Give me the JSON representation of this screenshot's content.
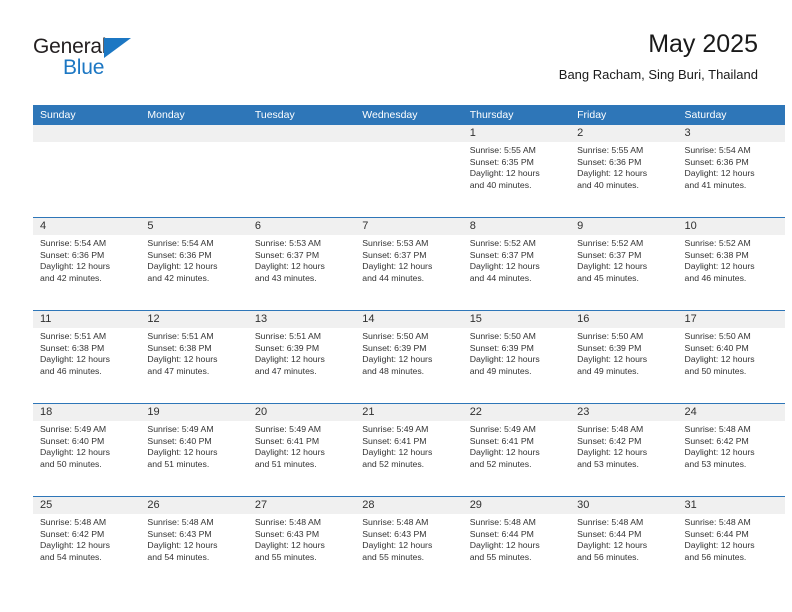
{
  "brand": {
    "name_top": "General",
    "name_bottom": "Blue",
    "accent_color": "#1c77c3"
  },
  "header": {
    "title": "May 2025",
    "subtitle": "Bang Racham, Sing Buri, Thailand"
  },
  "theme": {
    "header_blue": "#2e76b8",
    "day_number_bg": "#f0f0f0",
    "text_color": "#333333"
  },
  "weekdays": [
    "Sunday",
    "Monday",
    "Tuesday",
    "Wednesday",
    "Thursday",
    "Friday",
    "Saturday"
  ],
  "weeks": [
    [
      {
        "day": "",
        "empty": true
      },
      {
        "day": "",
        "empty": true
      },
      {
        "day": "",
        "empty": true
      },
      {
        "day": "",
        "empty": true
      },
      {
        "day": "1",
        "sunrise": "Sunrise: 5:55 AM",
        "sunset": "Sunset: 6:35 PM",
        "daylight_1": "Daylight: 12 hours",
        "daylight_2": "and 40 minutes."
      },
      {
        "day": "2",
        "sunrise": "Sunrise: 5:55 AM",
        "sunset": "Sunset: 6:36 PM",
        "daylight_1": "Daylight: 12 hours",
        "daylight_2": "and 40 minutes."
      },
      {
        "day": "3",
        "sunrise": "Sunrise: 5:54 AM",
        "sunset": "Sunset: 6:36 PM",
        "daylight_1": "Daylight: 12 hours",
        "daylight_2": "and 41 minutes."
      }
    ],
    [
      {
        "day": "4",
        "sunrise": "Sunrise: 5:54 AM",
        "sunset": "Sunset: 6:36 PM",
        "daylight_1": "Daylight: 12 hours",
        "daylight_2": "and 42 minutes."
      },
      {
        "day": "5",
        "sunrise": "Sunrise: 5:54 AM",
        "sunset": "Sunset: 6:36 PM",
        "daylight_1": "Daylight: 12 hours",
        "daylight_2": "and 42 minutes."
      },
      {
        "day": "6",
        "sunrise": "Sunrise: 5:53 AM",
        "sunset": "Sunset: 6:37 PM",
        "daylight_1": "Daylight: 12 hours",
        "daylight_2": "and 43 minutes."
      },
      {
        "day": "7",
        "sunrise": "Sunrise: 5:53 AM",
        "sunset": "Sunset: 6:37 PM",
        "daylight_1": "Daylight: 12 hours",
        "daylight_2": "and 44 minutes."
      },
      {
        "day": "8",
        "sunrise": "Sunrise: 5:52 AM",
        "sunset": "Sunset: 6:37 PM",
        "daylight_1": "Daylight: 12 hours",
        "daylight_2": "and 44 minutes."
      },
      {
        "day": "9",
        "sunrise": "Sunrise: 5:52 AM",
        "sunset": "Sunset: 6:37 PM",
        "daylight_1": "Daylight: 12 hours",
        "daylight_2": "and 45 minutes."
      },
      {
        "day": "10",
        "sunrise": "Sunrise: 5:52 AM",
        "sunset": "Sunset: 6:38 PM",
        "daylight_1": "Daylight: 12 hours",
        "daylight_2": "and 46 minutes."
      }
    ],
    [
      {
        "day": "11",
        "sunrise": "Sunrise: 5:51 AM",
        "sunset": "Sunset: 6:38 PM",
        "daylight_1": "Daylight: 12 hours",
        "daylight_2": "and 46 minutes."
      },
      {
        "day": "12",
        "sunrise": "Sunrise: 5:51 AM",
        "sunset": "Sunset: 6:38 PM",
        "daylight_1": "Daylight: 12 hours",
        "daylight_2": "and 47 minutes."
      },
      {
        "day": "13",
        "sunrise": "Sunrise: 5:51 AM",
        "sunset": "Sunset: 6:39 PM",
        "daylight_1": "Daylight: 12 hours",
        "daylight_2": "and 47 minutes."
      },
      {
        "day": "14",
        "sunrise": "Sunrise: 5:50 AM",
        "sunset": "Sunset: 6:39 PM",
        "daylight_1": "Daylight: 12 hours",
        "daylight_2": "and 48 minutes."
      },
      {
        "day": "15",
        "sunrise": "Sunrise: 5:50 AM",
        "sunset": "Sunset: 6:39 PM",
        "daylight_1": "Daylight: 12 hours",
        "daylight_2": "and 49 minutes."
      },
      {
        "day": "16",
        "sunrise": "Sunrise: 5:50 AM",
        "sunset": "Sunset: 6:39 PM",
        "daylight_1": "Daylight: 12 hours",
        "daylight_2": "and 49 minutes."
      },
      {
        "day": "17",
        "sunrise": "Sunrise: 5:50 AM",
        "sunset": "Sunset: 6:40 PM",
        "daylight_1": "Daylight: 12 hours",
        "daylight_2": "and 50 minutes."
      }
    ],
    [
      {
        "day": "18",
        "sunrise": "Sunrise: 5:49 AM",
        "sunset": "Sunset: 6:40 PM",
        "daylight_1": "Daylight: 12 hours",
        "daylight_2": "and 50 minutes."
      },
      {
        "day": "19",
        "sunrise": "Sunrise: 5:49 AM",
        "sunset": "Sunset: 6:40 PM",
        "daylight_1": "Daylight: 12 hours",
        "daylight_2": "and 51 minutes."
      },
      {
        "day": "20",
        "sunrise": "Sunrise: 5:49 AM",
        "sunset": "Sunset: 6:41 PM",
        "daylight_1": "Daylight: 12 hours",
        "daylight_2": "and 51 minutes."
      },
      {
        "day": "21",
        "sunrise": "Sunrise: 5:49 AM",
        "sunset": "Sunset: 6:41 PM",
        "daylight_1": "Daylight: 12 hours",
        "daylight_2": "and 52 minutes."
      },
      {
        "day": "22",
        "sunrise": "Sunrise: 5:49 AM",
        "sunset": "Sunset: 6:41 PM",
        "daylight_1": "Daylight: 12 hours",
        "daylight_2": "and 52 minutes."
      },
      {
        "day": "23",
        "sunrise": "Sunrise: 5:48 AM",
        "sunset": "Sunset: 6:42 PM",
        "daylight_1": "Daylight: 12 hours",
        "daylight_2": "and 53 minutes."
      },
      {
        "day": "24",
        "sunrise": "Sunrise: 5:48 AM",
        "sunset": "Sunset: 6:42 PM",
        "daylight_1": "Daylight: 12 hours",
        "daylight_2": "and 53 minutes."
      }
    ],
    [
      {
        "day": "25",
        "sunrise": "Sunrise: 5:48 AM",
        "sunset": "Sunset: 6:42 PM",
        "daylight_1": "Daylight: 12 hours",
        "daylight_2": "and 54 minutes."
      },
      {
        "day": "26",
        "sunrise": "Sunrise: 5:48 AM",
        "sunset": "Sunset: 6:43 PM",
        "daylight_1": "Daylight: 12 hours",
        "daylight_2": "and 54 minutes."
      },
      {
        "day": "27",
        "sunrise": "Sunrise: 5:48 AM",
        "sunset": "Sunset: 6:43 PM",
        "daylight_1": "Daylight: 12 hours",
        "daylight_2": "and 55 minutes."
      },
      {
        "day": "28",
        "sunrise": "Sunrise: 5:48 AM",
        "sunset": "Sunset: 6:43 PM",
        "daylight_1": "Daylight: 12 hours",
        "daylight_2": "and 55 minutes."
      },
      {
        "day": "29",
        "sunrise": "Sunrise: 5:48 AM",
        "sunset": "Sunset: 6:44 PM",
        "daylight_1": "Daylight: 12 hours",
        "daylight_2": "and 55 minutes."
      },
      {
        "day": "30",
        "sunrise": "Sunrise: 5:48 AM",
        "sunset": "Sunset: 6:44 PM",
        "daylight_1": "Daylight: 12 hours",
        "daylight_2": "and 56 minutes."
      },
      {
        "day": "31",
        "sunrise": "Sunrise: 5:48 AM",
        "sunset": "Sunset: 6:44 PM",
        "daylight_1": "Daylight: 12 hours",
        "daylight_2": "and 56 minutes."
      }
    ]
  ]
}
